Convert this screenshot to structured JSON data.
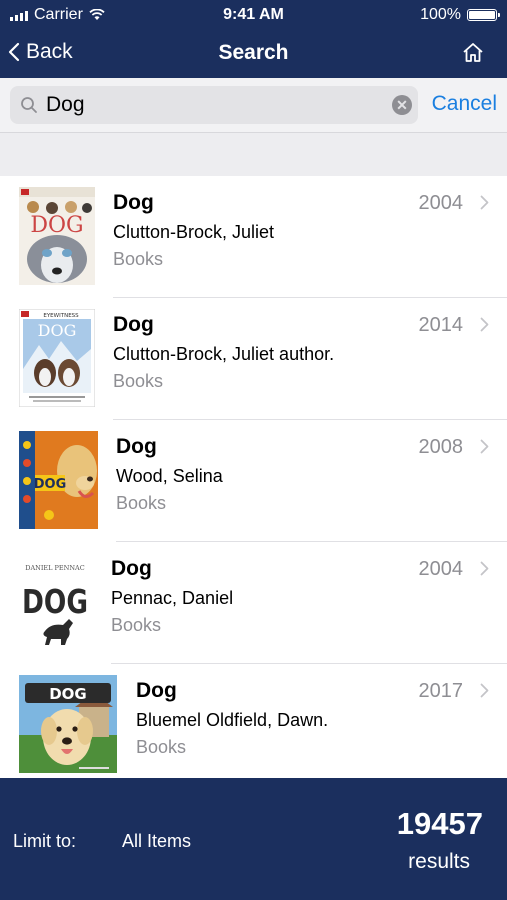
{
  "status_bar": {
    "carrier": "Carrier",
    "time": "9:41 AM",
    "battery": "100%"
  },
  "nav": {
    "back_label": "Back",
    "title": "Search"
  },
  "search": {
    "query": "Dog",
    "cancel_label": "Cancel"
  },
  "results": [
    {
      "title": "Dog",
      "author": "Clutton-Brock, Juliet",
      "format": "Books",
      "year": "2004",
      "cover_text": "DOG",
      "cover_top_text": "DK"
    },
    {
      "title": "Dog",
      "author": "Clutton-Brock, Juliet author.",
      "format": "Books",
      "year": "2014",
      "cover_text": "DOG",
      "cover_top_text": "EYEWITNESS"
    },
    {
      "title": "Dog",
      "author": "Wood, Selina",
      "format": "Books",
      "year": "2008",
      "cover_text": "DOG"
    },
    {
      "title": "Dog",
      "author": "Pennac, Daniel",
      "format": "Books",
      "year": "2004",
      "cover_text": "DOG",
      "cover_top_text": "DANIEL PENNAC"
    },
    {
      "title": "Dog",
      "author": "Bluemel Oldfield, Dawn.",
      "format": "Books",
      "year": "2017",
      "cover_text": "DOG"
    }
  ],
  "footer": {
    "limit_label": "Limit to:",
    "limit_value": "All Items",
    "count": "19457",
    "count_label": "results"
  },
  "colors": {
    "nav_bg": "#1b2f5e",
    "accent": "#1a7fe0",
    "secondary_text": "#8e8e93"
  }
}
